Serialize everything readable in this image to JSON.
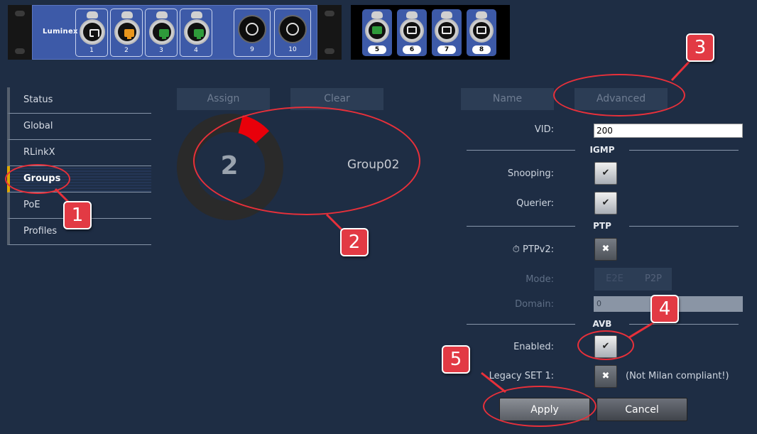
{
  "device": {
    "brand": "Luminex",
    "ports": [
      {
        "label": "1",
        "color": "#111111"
      },
      {
        "label": "2",
        "color": "#e8961c"
      },
      {
        "label": "3",
        "color": "#2e9a3a"
      },
      {
        "label": "4",
        "color": "#2e9a3a"
      }
    ],
    "fiber_ports": [
      {
        "label": "9"
      },
      {
        "label": "10"
      }
    ],
    "expansion_ports": [
      {
        "label": "5",
        "color": "#2e9a3a"
      },
      {
        "label": "6",
        "color": "#111111"
      },
      {
        "label": "7",
        "color": "#111111"
      },
      {
        "label": "8",
        "color": "#111111"
      }
    ]
  },
  "sidebar": {
    "items": [
      {
        "label": "Status"
      },
      {
        "label": "Global"
      },
      {
        "label": "RLinkX"
      },
      {
        "label": "Groups",
        "active": true
      },
      {
        "label": "PoE"
      },
      {
        "label": "Profiles"
      }
    ]
  },
  "group": {
    "assign_label": "Assign",
    "clear_label": "Clear",
    "number": "2",
    "name": "Group02",
    "accent": "#e8000a"
  },
  "settings": {
    "tabs": {
      "name": "Name",
      "advanced": "Advanced"
    },
    "vid_label": "VID:",
    "vid_value": "200",
    "igmp": {
      "title": "IGMP",
      "snooping_label": "Snooping:",
      "snooping": "✔",
      "querier_label": "Querier:",
      "querier": "✔"
    },
    "ptp": {
      "title": "PTP",
      "ptpv2_icon": "⏱",
      "ptpv2_label": "PTPv2:",
      "ptpv2": "✖",
      "mode_label": "Mode:",
      "mode_options": [
        "E2E",
        "P2P"
      ],
      "domain_label": "Domain:",
      "domain_value": "0"
    },
    "avb": {
      "title": "AVB",
      "enabled_label": "Enabled:",
      "enabled": "✔",
      "legacy_label": "Legacy SET 1:",
      "legacy": "✖",
      "legacy_note": "(Not Milan compliant!)"
    },
    "apply_label": "Apply",
    "cancel_label": "Cancel"
  },
  "annotations": {
    "callouts": [
      "1",
      "2",
      "3",
      "4",
      "5"
    ],
    "color": "#e23a44"
  }
}
